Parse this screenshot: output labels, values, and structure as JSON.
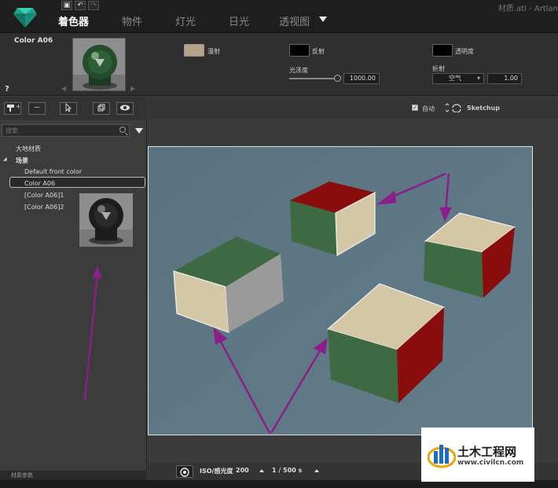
{
  "window": {
    "title": "材质.atl - Artlan"
  },
  "toolbar_icons": [
    {
      "name": "save-icon",
      "glyph": "▣"
    },
    {
      "name": "undo-icon",
      "glyph": "↶"
    },
    {
      "name": "redo-icon",
      "glyph": "↷"
    }
  ],
  "nav": {
    "tabs": [
      "着色器",
      "物件",
      "灯光",
      "日光",
      "透视图"
    ],
    "active": 0
  },
  "material": {
    "name": "Color A06",
    "help": "?",
    "prev": "◀",
    "next": "▶",
    "diffuse_label": "漫射",
    "diffuse_color": "#b5a288",
    "reflection_label": "反射",
    "reflection_color": "#000000",
    "transparency_label": "透明度",
    "transparency_color": "#000000",
    "gloss_label": "光泽度",
    "gloss_value": "1000.00",
    "refraction_label": "折射",
    "refraction_medium": "空气",
    "refraction_value": "1.00"
  },
  "left_panel": {
    "tool_buttons": [
      "",
      "－",
      "",
      "",
      ""
    ],
    "search_placeholder": "搜索",
    "tree": {
      "root": "大地材质",
      "scene_toggle": "◢",
      "scene": "场景",
      "items": [
        "Default front color",
        "Color A06",
        "[Color A06]1",
        "[Color A06]2"
      ],
      "selected": 1
    },
    "footer": "材质参数"
  },
  "render": {
    "auto_label": "自动",
    "auto_checked": "✓",
    "engine_label": "Sketchup",
    "iso_label": "ISO/感光度",
    "iso_value": "200",
    "shutter_value": "1 / 500 s"
  },
  "colors": {
    "viewport_bg": "#5e7684",
    "green": "#3d6a42",
    "red": "#8a0d0d",
    "tan": "#d4c7a5",
    "gray": "#9a9a9a",
    "arrow": "#8a1e8a"
  },
  "watermark": {
    "title": "土木工程网",
    "url": "www.civilcn.com"
  }
}
